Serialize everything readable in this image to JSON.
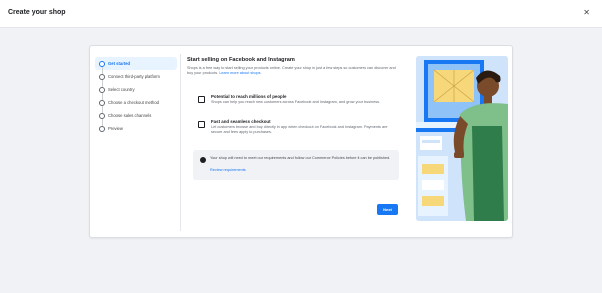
{
  "topbar": {
    "title": "Create your shop",
    "close_icon": "close-icon",
    "close_glyph": "✕"
  },
  "steps": [
    {
      "label": "Get started",
      "active": true
    },
    {
      "label": "Connect third-party platform",
      "active": false
    },
    {
      "label": "Select country",
      "active": false
    },
    {
      "label": "Choose a checkout method",
      "active": false
    },
    {
      "label": "Choose sales channels",
      "active": false
    },
    {
      "label": "Preview",
      "active": false
    }
  ],
  "main": {
    "title": "Start selling on Facebook and Instagram",
    "intro": "Shops is a free way to start selling your products online. Create your shop in just a few steps so customers can discover and buy your products.",
    "intro_link": "Learn more about shops"
  },
  "features": [
    {
      "icon": "shop-icon",
      "title": "Potential to reach millions of people",
      "desc": "Shops can help you reach new customers across Facebook and Instagram, and grow your business."
    },
    {
      "icon": "checkout-icon",
      "title": "Fast and seamless checkout",
      "desc": "Let customers browse and buy directly in app when checkout on Facebook and Instagram. Payments are secure and fees apply to purchases."
    }
  ],
  "notice": {
    "icon": "info-icon",
    "text": "Your shop will need to meet our requirements and follow our Commerce Policies before it can be published.",
    "link": "Review requirements"
  },
  "next_button": {
    "label": "Next"
  },
  "illustration": {
    "name": "shop-owner-illustration"
  },
  "colors": {
    "accent": "#1877f2",
    "background": "#f0f2f5",
    "card": "#ffffff",
    "active_step_bg": "#e7f3ff"
  }
}
